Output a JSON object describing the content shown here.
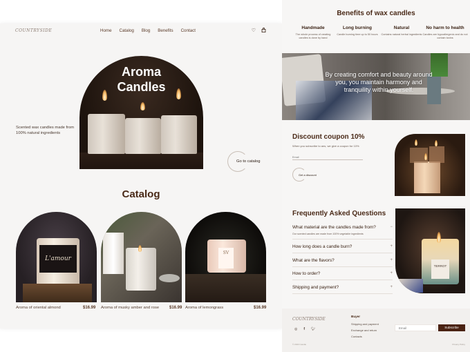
{
  "landing": {
    "logo": "COUNTRYSIDE",
    "nav": [
      "Home",
      "Catalog",
      "Blog",
      "Benefits",
      "Contact"
    ],
    "icons": {
      "favorites": "heart-icon",
      "cart": "bag-icon"
    },
    "hero": {
      "title_line1": "Aroma",
      "title_line2": "Candles",
      "description": "Scented wax candles made from 100% natural ingredients",
      "cta": "Go to catalog"
    },
    "catalog": {
      "title": "Catalog",
      "products": [
        {
          "name": "Aroma of oriental almond",
          "price": "$16.99",
          "label": "L'amour"
        },
        {
          "name": "Aroma of musky amber and rose",
          "price": "$16.99"
        },
        {
          "name": "Aroma of lemongrass",
          "price": "$16.99",
          "label": "SV"
        }
      ]
    }
  },
  "details": {
    "benefits": {
      "title": "Benefits of wax candles",
      "items": [
        {
          "title": "Handmade",
          "text": "The whole process of creating candles is done by hand"
        },
        {
          "title": "Long burning",
          "text": "Candle burning time up to 50 hours"
        },
        {
          "title": "Natural",
          "text": "Contains natural herbal ingredients"
        },
        {
          "title": "No harm to health",
          "text": "Candles are hypoallergenic and do not contain toxins"
        }
      ]
    },
    "banner_quote": "By creating comfort and beauty around you, you maintain harmony and tranquility within yourself.",
    "coupon": {
      "title": "Discount coupon 10%",
      "subtitle": "When you subscribe to ans, we give a coupon for 10%",
      "email_placeholder": "Email",
      "button": "Get a discount"
    },
    "faq": {
      "title": "Frequently Asked Questions",
      "items": [
        {
          "question": "What material are the candles made from?",
          "answer": "Our scented candles are made from 100% vegetable ingredients",
          "expanded": true,
          "sign": "−"
        },
        {
          "question": "How long does a candle burn?",
          "expanded": false,
          "sign": "+"
        },
        {
          "question": "What are the flavors?",
          "expanded": false,
          "sign": "+"
        },
        {
          "question": "How to order?",
          "expanded": false,
          "sign": "+"
        },
        {
          "question": "Shipping and payment?",
          "expanded": false,
          "sign": "+"
        }
      ],
      "image_label": "TERROT"
    },
    "footer": {
      "logo": "COUNTRYSIDE",
      "social": [
        "instagram-icon",
        "facebook-icon",
        "twitter-icon"
      ],
      "buyer_heading": "Buyer",
      "buyer_links": [
        "Shipping and payment",
        "Exchange and return",
        "Contacts"
      ],
      "email_placeholder": "Email",
      "subscribe": "Subscribe",
      "copyright": "© 2023 Candle",
      "privacy": "Privacy Policy"
    }
  }
}
